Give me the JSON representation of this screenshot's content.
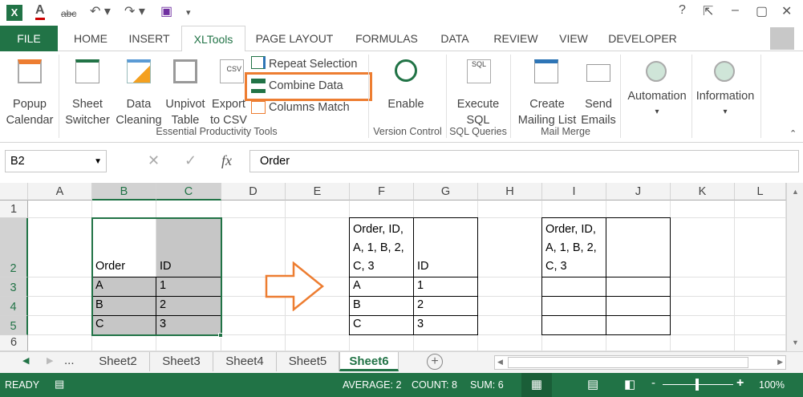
{
  "title_bar": {
    "help": "?",
    "minimize": "–",
    "restore": "▢",
    "close": "✕"
  },
  "tabs": [
    "FILE",
    "HOME",
    "INSERT",
    "XLTools",
    "PAGE LAYOUT",
    "FORMULAS",
    "DATA",
    "REVIEW",
    "VIEW",
    "DEVELOPER"
  ],
  "active_tab": "XLTools",
  "ribbon": {
    "buttons": [
      {
        "label1": "Popup",
        "label2": "Calendar"
      },
      {
        "label1": "Sheet",
        "label2": "Switcher"
      },
      {
        "label1": "Data",
        "label2": "Cleaning"
      },
      {
        "label1": "Unpivot",
        "label2": "Table"
      },
      {
        "label1": "Export",
        "label2": "to CSV"
      },
      {
        "label1": "Enable",
        "label2": ""
      },
      {
        "label1": "Execute",
        "label2": "SQL"
      },
      {
        "label1": "Create",
        "label2": "Mailing List"
      },
      {
        "label1": "Send",
        "label2": "Emails"
      },
      {
        "label1": "Automation",
        "label2": "▾"
      },
      {
        "label1": "Information",
        "label2": "▾"
      }
    ],
    "small_buttons": [
      "Repeat Selection",
      "Combine Data",
      "Columns Match"
    ],
    "highlighted": "Combine Data",
    "groups": [
      "Essential Productivity Tools",
      "Version Control",
      "SQL Queries",
      "Mail Merge"
    ]
  },
  "formula_bar": {
    "name_box": "B2",
    "fx": "fx",
    "value": "Order"
  },
  "columns": [
    "A",
    "B",
    "C",
    "D",
    "E",
    "F",
    "G",
    "H",
    "I",
    "J",
    "K",
    "L"
  ],
  "rows": [
    "1",
    "2",
    "3",
    "4",
    "5",
    "6"
  ],
  "cells": {
    "B2": "Order",
    "C2": "ID",
    "B3": "A",
    "C3": "1",
    "B4": "B",
    "C4": "2",
    "B5": "C",
    "C5": "3",
    "F2": "Order, ID, A, 1, B, 2, C, 3",
    "G2": "ID",
    "F3": "A",
    "G3": "1",
    "F4": "B",
    "G4": "2",
    "F5": "C",
    "G5": "3",
    "I2": "Order, ID, A, 1, B, 2, C, 3"
  },
  "sheets": [
    "Sheet2",
    "Sheet3",
    "Sheet4",
    "Sheet5",
    "Sheet6"
  ],
  "active_sheet": "Sheet6",
  "sheet_nav": {
    "more": "...",
    "add": "+"
  },
  "status": {
    "mode": "READY",
    "average": "AVERAGE: 2",
    "count": "COUNT: 8",
    "sum": "SUM: 6",
    "zoom": "100%",
    "zoom_level": 100
  },
  "colors": {
    "excel_green": "#217346",
    "highlight_orange": "#ed7d31",
    "selection_fill": "#c6c6c6"
  }
}
